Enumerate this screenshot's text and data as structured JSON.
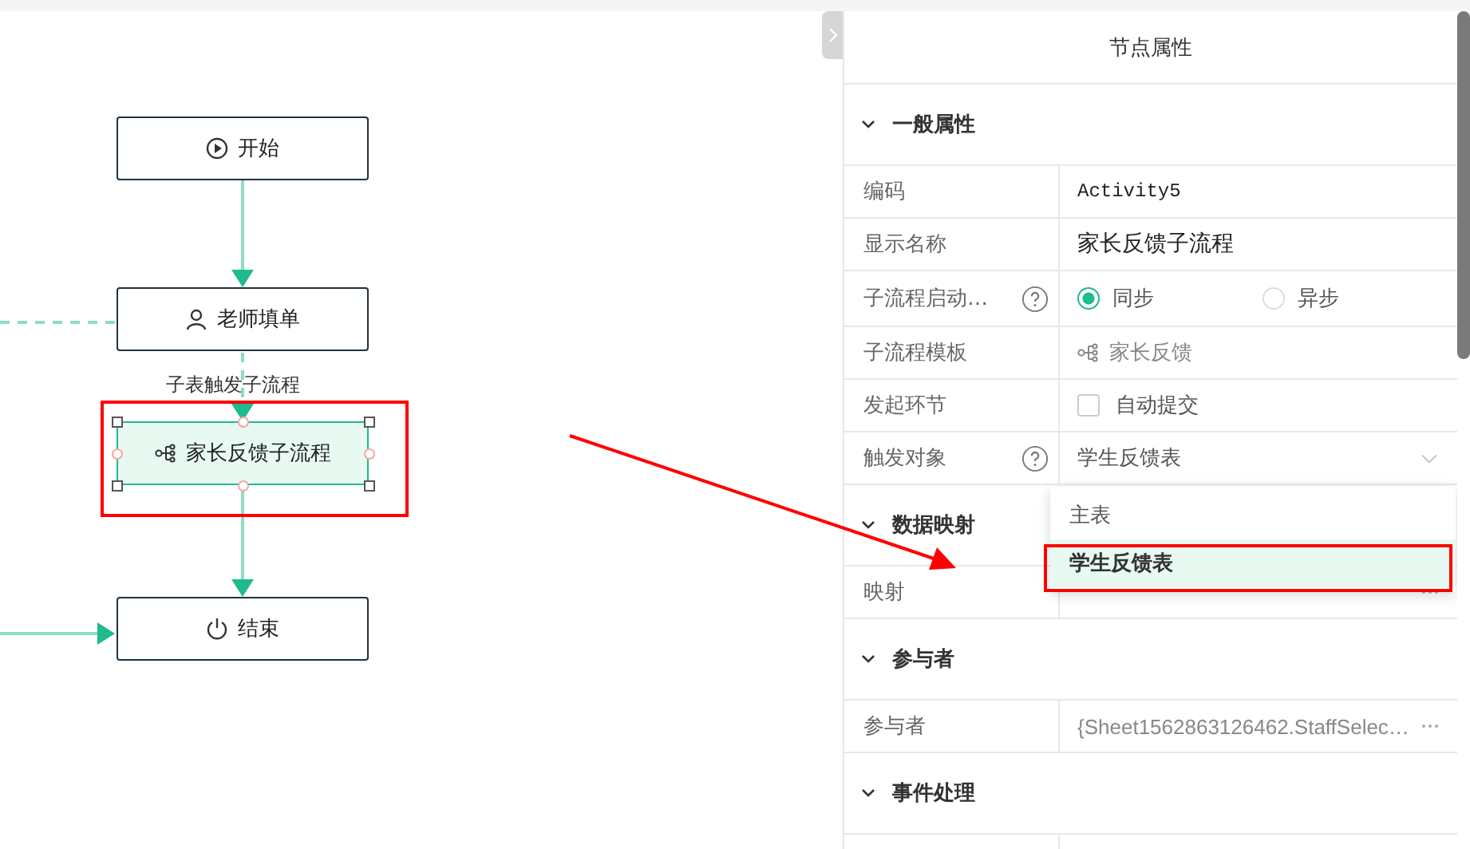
{
  "canvas": {
    "nodes": [
      {
        "kind": "start",
        "label": "开始",
        "selected": false
      },
      {
        "kind": "user",
        "label": "老师填单",
        "selected": false
      },
      {
        "kind": "subflow",
        "label": "家长反馈子流程",
        "selected": true
      },
      {
        "kind": "end",
        "label": "结束",
        "selected": false
      }
    ],
    "edge_label": "子表触发子流程"
  },
  "panel": {
    "title": "节点属性",
    "sections": [
      {
        "title": "一般属性",
        "expanded": true,
        "rows": [
          {
            "kind": "code",
            "label": "编码",
            "value": "Activity5"
          },
          {
            "kind": "text",
            "label": "显示名称",
            "value": "家长反馈子流程"
          },
          {
            "kind": "radio",
            "label": "子流程启动…",
            "help": true,
            "options": [
              {
                "label": "同步",
                "selected": true
              },
              {
                "label": "异步",
                "selected": false
              }
            ]
          },
          {
            "kind": "template",
            "label": "子流程模板",
            "value": "家长反馈"
          },
          {
            "kind": "checkbox",
            "label": "发起环节",
            "value": "自动提交",
            "checked": false
          },
          {
            "kind": "select",
            "label": "触发对象",
            "help": true,
            "value": "学生反馈表"
          }
        ]
      },
      {
        "title": "数据映射",
        "expanded": true,
        "rows": [
          {
            "kind": "more",
            "label": "映射"
          }
        ]
      },
      {
        "title": "参与者",
        "expanded": true,
        "rows": [
          {
            "kind": "more",
            "label": "参与者",
            "value": "{Sheet1562863126462.StaffSelec…"
          }
        ]
      },
      {
        "title": "事件处理",
        "expanded": true
      }
    ]
  },
  "dropdown": {
    "options": [
      {
        "label": "主表",
        "selected": false
      },
      {
        "label": "学生反馈表",
        "selected": true
      }
    ]
  }
}
